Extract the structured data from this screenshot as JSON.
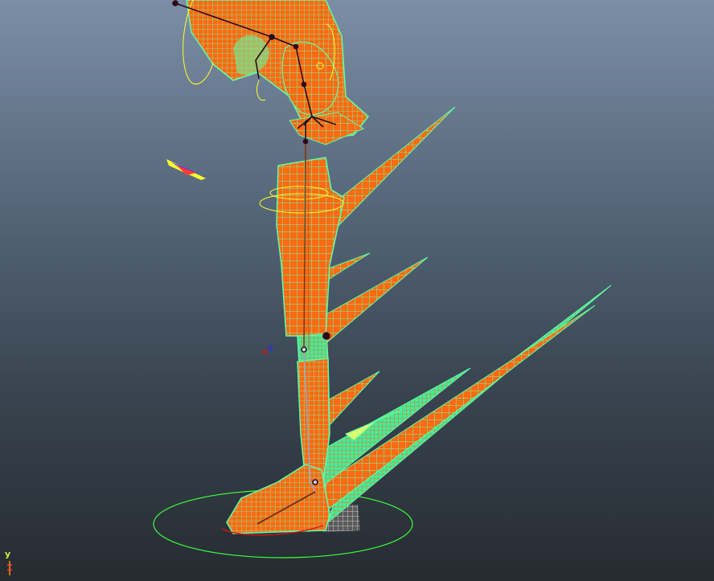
{
  "viewport": {
    "background_top": "#7c8ea5",
    "background_bottom": "#262b31",
    "mesh_fill_color": "#ff6a12",
    "wireframe_color": "#5cffa8",
    "joint_color": "#2a0a1c",
    "ground_ring_color": "#3cff3c",
    "selection_curve_color": "#ffff2c",
    "foot_curve_color": "#e01010"
  },
  "axis_gizmo": {
    "y_label": "y",
    "y_color": "#c8f03c",
    "z_color": "#ff3a3a",
    "x_color": "#ff8a00"
  },
  "icons": {
    "pivot": "pivot-cross-icon",
    "axis": "axis-gizmo-icon"
  }
}
